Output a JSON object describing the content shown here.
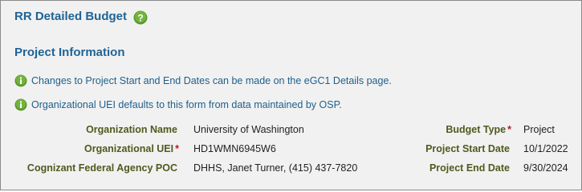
{
  "page": {
    "title": "RR Detailed Budget",
    "section_title": "Project Information"
  },
  "icons": {
    "help": "help-question-icon",
    "info": "info-icon",
    "required": "required-asterisk"
  },
  "colors": {
    "heading": "#1f6396",
    "info_text": "#1f5f8b",
    "label": "#4f5a1e",
    "required": "#b31b1b",
    "icon_green": "#5a9a2b",
    "panel_bg": "#f1f1f1"
  },
  "info_messages": [
    "Changes to Project Start and End Dates can be made on the eGC1 Details page.",
    "Organizational UEI defaults to this form from data maintained by OSP."
  ],
  "fields_left": [
    {
      "label": "Organization Name",
      "required": "",
      "value": "University of Washington"
    },
    {
      "label": "Organizational UEI",
      "required": "*",
      "value": "HD1WMN6945W6"
    },
    {
      "label": "Cognizant Federal Agency POC",
      "required": "",
      "value": "DHHS, Janet Turner, (415) 437-7820"
    }
  ],
  "fields_right": [
    {
      "label": "Budget Type",
      "required": "*",
      "value": "Project"
    },
    {
      "label": "Project Start Date",
      "required": "",
      "value": "10/1/2022"
    },
    {
      "label": "Project End Date",
      "required": "",
      "value": "9/30/2024"
    }
  ]
}
